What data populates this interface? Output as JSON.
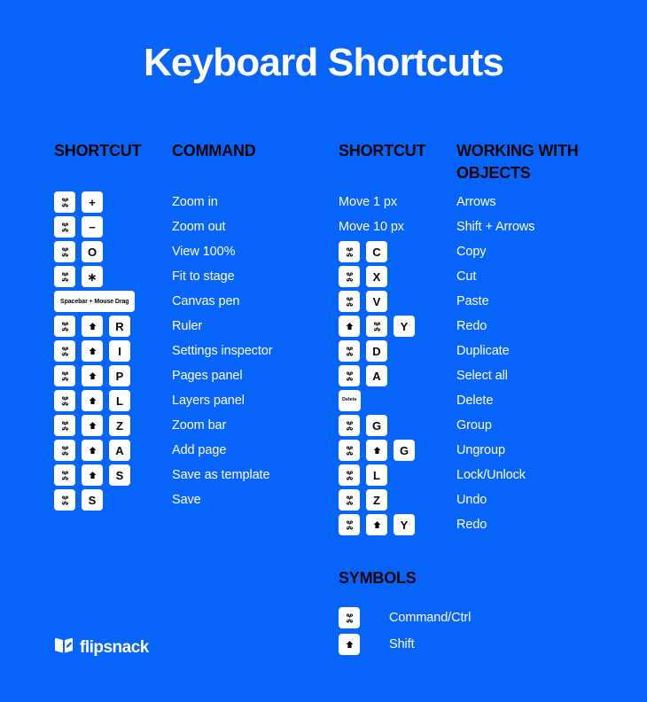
{
  "title": "Keyboard Shortcuts",
  "headers": {
    "shortcut_left": "SHORTCUT",
    "command": "COMMAND",
    "shortcut_right": "SHORTCUT",
    "working_with_objects": "WORKING WITH OBJECTS",
    "symbols": "SYMBOLS"
  },
  "colors": {
    "background": "#0764FB",
    "key_face": "#FFFFFF",
    "key_text": "#050505",
    "label_text": "#FFFFFF",
    "header_text": "#050505"
  },
  "left_rows": [
    {
      "keys": [
        {
          "type": "glyph",
          "name": "command-icon",
          "text": "⌘"
        },
        {
          "type": "glyph",
          "name": "plus-icon",
          "text": "+"
        }
      ],
      "label": "Zoom in"
    },
    {
      "keys": [
        {
          "type": "glyph",
          "name": "command-icon",
          "text": "⌘"
        },
        {
          "type": "glyph",
          "name": "minus-icon",
          "text": "−"
        }
      ],
      "label": "Zoom out"
    },
    {
      "keys": [
        {
          "type": "glyph",
          "name": "command-icon",
          "text": "⌘"
        },
        {
          "type": "letter",
          "name": "key-o",
          "text": "O"
        }
      ],
      "label": "View 100%"
    },
    {
      "keys": [
        {
          "type": "glyph",
          "name": "command-icon",
          "text": "⌘"
        },
        {
          "type": "glyph",
          "name": "asterisk-icon",
          "text": "∗"
        }
      ],
      "label": "Fit to stage"
    },
    {
      "keys": [
        {
          "type": "wide",
          "name": "key-spacebar-mouse-drag",
          "text": "Spacebar + Mouse Drag"
        }
      ],
      "label": "Canvas pen"
    },
    {
      "keys": [
        {
          "type": "glyph",
          "name": "command-icon",
          "text": "⌘"
        },
        {
          "type": "shift",
          "name": "shift-icon",
          "text": "⇧"
        },
        {
          "type": "letter",
          "name": "key-r",
          "text": "R"
        }
      ],
      "label": "Ruler"
    },
    {
      "keys": [
        {
          "type": "glyph",
          "name": "command-icon",
          "text": "⌘"
        },
        {
          "type": "shift",
          "name": "shift-icon",
          "text": "⇧"
        },
        {
          "type": "letter",
          "name": "key-i",
          "text": "I"
        }
      ],
      "label": "Settings inspector"
    },
    {
      "keys": [
        {
          "type": "glyph",
          "name": "command-icon",
          "text": "⌘"
        },
        {
          "type": "shift",
          "name": "shift-icon",
          "text": "⇧"
        },
        {
          "type": "letter",
          "name": "key-p",
          "text": "P"
        }
      ],
      "label": "Pages panel"
    },
    {
      "keys": [
        {
          "type": "glyph",
          "name": "command-icon",
          "text": "⌘"
        },
        {
          "type": "shift",
          "name": "shift-icon",
          "text": "⇧"
        },
        {
          "type": "letter",
          "name": "key-l",
          "text": "L"
        }
      ],
      "label": "Layers panel"
    },
    {
      "keys": [
        {
          "type": "glyph",
          "name": "command-icon",
          "text": "⌘"
        },
        {
          "type": "shift",
          "name": "shift-icon",
          "text": "⇧"
        },
        {
          "type": "letter",
          "name": "key-z",
          "text": "Z"
        }
      ],
      "label": "Zoom bar"
    },
    {
      "keys": [
        {
          "type": "glyph",
          "name": "command-icon",
          "text": "⌘"
        },
        {
          "type": "shift",
          "name": "shift-icon",
          "text": "⇧"
        },
        {
          "type": "letter",
          "name": "key-a",
          "text": "A"
        }
      ],
      "label": "Add page"
    },
    {
      "keys": [
        {
          "type": "glyph",
          "name": "command-icon",
          "text": "⌘"
        },
        {
          "type": "shift",
          "name": "shift-icon",
          "text": "⇧"
        },
        {
          "type": "letter",
          "name": "key-s",
          "text": "S"
        }
      ],
      "label": "Save as template"
    },
    {
      "keys": [
        {
          "type": "glyph",
          "name": "command-icon",
          "text": "⌘"
        },
        {
          "type": "letter",
          "name": "key-s",
          "text": "S"
        }
      ],
      "label": "Save"
    }
  ],
  "right_rows": [
    {
      "plain": "Move 1 px",
      "label": "Arrows"
    },
    {
      "plain": "Move 10 px",
      "label": "Shift + Arrows"
    },
    {
      "keys": [
        {
          "type": "glyph",
          "name": "command-icon",
          "text": "⌘"
        },
        {
          "type": "letter",
          "name": "key-c",
          "text": "C"
        }
      ],
      "label": "Copy"
    },
    {
      "keys": [
        {
          "type": "glyph",
          "name": "command-icon",
          "text": "⌘"
        },
        {
          "type": "letter",
          "name": "key-x",
          "text": "X"
        }
      ],
      "label": "Cut"
    },
    {
      "keys": [
        {
          "type": "glyph",
          "name": "command-icon",
          "text": "⌘"
        },
        {
          "type": "letter",
          "name": "key-v",
          "text": "V"
        }
      ],
      "label": "Paste"
    },
    {
      "keys": [
        {
          "type": "shift",
          "name": "shift-icon",
          "text": "⇧"
        },
        {
          "type": "glyph",
          "name": "command-icon",
          "text": "⌘"
        },
        {
          "type": "letter",
          "name": "key-y",
          "text": "Y"
        }
      ],
      "label": "Redo"
    },
    {
      "keys": [
        {
          "type": "glyph",
          "name": "command-icon",
          "text": "⌘"
        },
        {
          "type": "letter",
          "name": "key-d",
          "text": "D"
        }
      ],
      "label": "Duplicate"
    },
    {
      "keys": [
        {
          "type": "glyph",
          "name": "command-icon",
          "text": "⌘"
        },
        {
          "type": "letter",
          "name": "key-a",
          "text": "A"
        }
      ],
      "label": "Select all"
    },
    {
      "keys": [
        {
          "type": "tiny",
          "name": "key-delete",
          "text": "Delete"
        }
      ],
      "label": "Delete"
    },
    {
      "keys": [
        {
          "type": "glyph",
          "name": "command-icon",
          "text": "⌘"
        },
        {
          "type": "letter",
          "name": "key-g",
          "text": "G"
        }
      ],
      "label": "Group"
    },
    {
      "keys": [
        {
          "type": "glyph",
          "name": "command-icon",
          "text": "⌘"
        },
        {
          "type": "shift",
          "name": "shift-icon",
          "text": "⇧"
        },
        {
          "type": "letter",
          "name": "key-g",
          "text": "G"
        }
      ],
      "label": "Ungroup"
    },
    {
      "keys": [
        {
          "type": "glyph",
          "name": "command-icon",
          "text": "⌘"
        },
        {
          "type": "letter",
          "name": "key-l",
          "text": "L"
        }
      ],
      "label": "Lock/Unlock"
    },
    {
      "keys": [
        {
          "type": "glyph",
          "name": "command-icon",
          "text": "⌘"
        },
        {
          "type": "letter",
          "name": "key-z",
          "text": "Z"
        }
      ],
      "label": "Undo"
    },
    {
      "keys": [
        {
          "type": "glyph",
          "name": "command-icon",
          "text": "⌘"
        },
        {
          "type": "shift",
          "name": "shift-icon",
          "text": "⇧"
        },
        {
          "type": "letter",
          "name": "key-y",
          "text": "Y"
        }
      ],
      "label": "Redo"
    }
  ],
  "symbol_rows": [
    {
      "keys": [
        {
          "type": "glyph",
          "name": "command-icon",
          "text": "⌘"
        }
      ],
      "label": "Command/Ctrl"
    },
    {
      "keys": [
        {
          "type": "shift",
          "name": "shift-icon",
          "text": "⇧"
        }
      ],
      "label": "Shift"
    }
  ],
  "footer": {
    "brand": "flipsnack",
    "logo_icon": "flipsnack-book-icon"
  }
}
